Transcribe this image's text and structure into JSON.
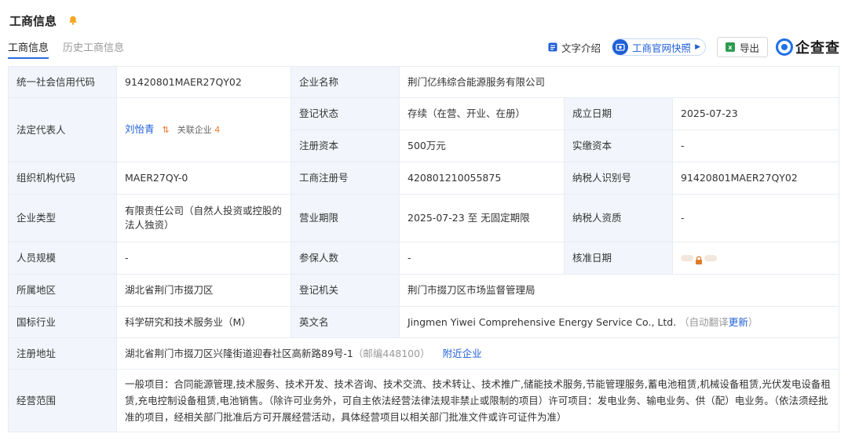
{
  "section": {
    "title": "工商信息"
  },
  "tabs": [
    {
      "label": "工商信息",
      "active": true
    },
    {
      "label": "历史工商信息",
      "active": false
    }
  ],
  "toolbar": {
    "intro_label": "文字介绍",
    "snapshot_label": "工商官网快照",
    "export_label": "导出",
    "brand_name": "企查查"
  },
  "colors": {
    "accent": "#1f5fd8",
    "label_bg": "#f2f6fc",
    "border": "#e8ecf2",
    "orange": "#f0792a"
  },
  "rows": {
    "credit_code": {
      "label": "统一社会信用代码",
      "value": "91420801MAER27QY02"
    },
    "company_name": {
      "label": "企业名称",
      "value": "荆门亿纬综合能源服务有限公司"
    },
    "legal_rep": {
      "label": "法定代表人",
      "value": "刘怡青",
      "assoc_label": "关联企业",
      "assoc_count": "4"
    },
    "reg_status": {
      "label": "登记状态",
      "value": "存续（在营、开业、在册）"
    },
    "founded": {
      "label": "成立日期",
      "value": "2025-07-23"
    },
    "reg_capital": {
      "label": "注册资本",
      "value": "500万元"
    },
    "paid_capital": {
      "label": "实缴资本",
      "value": "-"
    },
    "org_code": {
      "label": "组织机构代码",
      "value": "MAER27QY-0"
    },
    "biz_reg_no": {
      "label": "工商注册号",
      "value": "420801210055875"
    },
    "taxpayer_id": {
      "label": "纳税人识别号",
      "value": "91420801MAER27QY02"
    },
    "company_type": {
      "label": "企业类型",
      "value": "有限责任公司（自然人投资或控股的法人独资）"
    },
    "biz_term": {
      "label": "营业期限",
      "value": "2025-07-23 至 无固定期限"
    },
    "taxpayer_qual": {
      "label": "纳税人资质",
      "value": "-"
    },
    "staff_size": {
      "label": "人员规模",
      "value": "-"
    },
    "insured": {
      "label": "参保人数",
      "value": "-"
    },
    "approval_date": {
      "label": "核准日期",
      "value": ""
    },
    "region": {
      "label": "所属地区",
      "value": "湖北省荆门市掇刀区"
    },
    "reg_authority": {
      "label": "登记机关",
      "value": "荆门市掇刀区市场监督管理局"
    },
    "industry": {
      "label": "国标行业",
      "value": "科学研究和技术服务业（M）"
    },
    "english_name": {
      "label": "英文名",
      "value": "Jingmen Yiwei Comprehensive Energy Service Co., Ltd.",
      "note_prefix": "（自动翻译",
      "note_link": "更新",
      "note_suffix": "）"
    },
    "address": {
      "label": "注册地址",
      "value": "湖北省荆门市掇刀区兴隆街道迎春社区高新路89号-1",
      "postcode": "（邮编448100）",
      "nearby_label": "附近企业"
    },
    "scope": {
      "label": "经营范围",
      "value": "一般项目：合同能源管理,技术服务、技术开发、技术咨询、技术交流、技术转让、技术推广,储能技术服务,节能管理服务,蓄电池租赁,机械设备租赁,光伏发电设备租赁,充电控制设备租赁,电池销售。（除许可业务外，可自主依法经营法律法规非禁止或限制的项目）许可项目：发电业务、输电业务、供（配）电业务。（依法须经批准的项目，经相关部门批准后方可开展经营活动，具体经营项目以相关部门批准文件或许可证件为准）"
    }
  }
}
